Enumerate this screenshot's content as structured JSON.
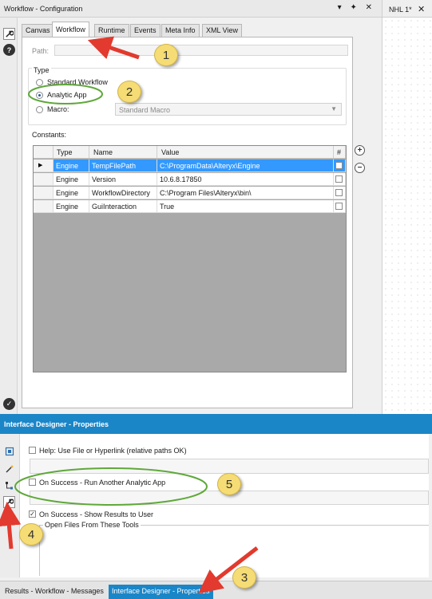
{
  "config": {
    "title": "Workflow - Configuration",
    "window_controls": "▾ ✦ ✕",
    "tabs": [
      "Canvas",
      "Workflow",
      "Runtime",
      "Events",
      "Meta Info",
      "XML View"
    ],
    "active_tab": "Workflow",
    "path_label": "Path:",
    "path_value": "",
    "type_label": "Type",
    "type_options": [
      "Standard Workflow",
      "Analytic App",
      "Macro:"
    ],
    "selected_type": "Analytic App",
    "macro_value": "Standard Macro",
    "constants_label": "Constants:",
    "columns": [
      "Type",
      "Name",
      "Value",
      "#"
    ],
    "rows": [
      {
        "type": "Engine",
        "name": "TempFilePath",
        "value": "C:\\ProgramData\\Alteryx\\Engine",
        "checked": false,
        "selected": true
      },
      {
        "type": "Engine",
        "name": "Version",
        "value": "10.6.8.17850",
        "checked": false,
        "selected": false
      },
      {
        "type": "Engine",
        "name": "WorkflowDirectory",
        "value": "C:\\Program Files\\Alteryx\\bin\\",
        "checked": false,
        "selected": false
      },
      {
        "type": "Engine",
        "name": "GuiInteraction",
        "value": "True",
        "checked": false,
        "selected": false
      }
    ]
  },
  "canvas": {
    "tab_label": "NHL 1*",
    "close_glyph": "✕"
  },
  "interface_designer": {
    "title": "Interface Designer - Properties",
    "help_label": "Help: Use File or Hyperlink (relative paths OK)",
    "help_checked": false,
    "on_success_run_label": "On Success - Run Another Analytic App",
    "on_success_run_checked": false,
    "show_results_label": "On Success - Show Results to User",
    "show_results_checked": true,
    "open_files_label": "Open Files From These Tools"
  },
  "bottom_tabs": [
    {
      "label": "Results - Workflow - Messages",
      "active": false
    },
    {
      "label": "Interface Designer - Properties",
      "active": true
    }
  ],
  "annotations": {
    "badges": [
      "1",
      "2",
      "3",
      "4",
      "5"
    ],
    "arrow_color": "#e23a2e",
    "ellipse_color": "#5fa83a",
    "badge_color": "#f5dc74"
  }
}
